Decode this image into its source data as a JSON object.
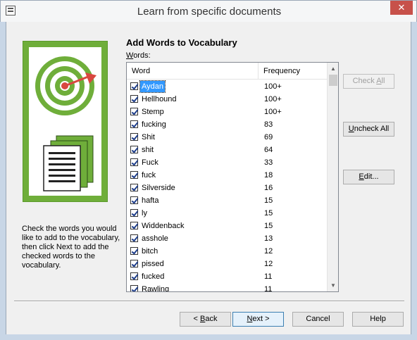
{
  "window": {
    "title": "Learn from specific documents"
  },
  "page": {
    "heading": "Add Words to Vocabulary",
    "words_label_accel": "W",
    "words_label_rest": "ords:",
    "instructions": "Check the words you would like to add to the vocabulary, then click Next to add the checked words to the vocabulary."
  },
  "list": {
    "columns": {
      "word": "Word",
      "frequency": "Frequency"
    },
    "rows": [
      {
        "word": "Aydan",
        "frequency": "100+",
        "checked": true,
        "selected": true
      },
      {
        "word": "Hellhound",
        "frequency": "100+",
        "checked": true
      },
      {
        "word": "Stemp",
        "frequency": "100+",
        "checked": true
      },
      {
        "word": "fucking",
        "frequency": "83",
        "checked": true
      },
      {
        "word": "Shit",
        "frequency": "69",
        "checked": true
      },
      {
        "word": "shit",
        "frequency": "64",
        "checked": true
      },
      {
        "word": "Fuck",
        "frequency": "33",
        "checked": true
      },
      {
        "word": "fuck",
        "frequency": "18",
        "checked": true
      },
      {
        "word": "Silverside",
        "frequency": "16",
        "checked": true
      },
      {
        "word": "hafta",
        "frequency": "15",
        "checked": true
      },
      {
        "word": "ly",
        "frequency": "15",
        "checked": true
      },
      {
        "word": "Widdenback",
        "frequency": "15",
        "checked": true
      },
      {
        "word": "asshole",
        "frequency": "13",
        "checked": true
      },
      {
        "word": "bitch",
        "frequency": "12",
        "checked": true
      },
      {
        "word": "pissed",
        "frequency": "12",
        "checked": true
      },
      {
        "word": "fucked",
        "frequency": "11",
        "checked": true
      },
      {
        "word": "Rawling",
        "frequency": "11",
        "checked": true
      }
    ]
  },
  "side_buttons": {
    "check_all": {
      "before": "Check ",
      "accel": "A",
      "after": "ll",
      "enabled": false
    },
    "uncheck_all": {
      "before": "",
      "accel": "U",
      "after": "ncheck All",
      "enabled": true
    },
    "edit": {
      "before": "",
      "accel": "E",
      "after": "dit...",
      "enabled": true
    }
  },
  "footer_buttons": {
    "back": {
      "before": "< ",
      "accel": "B",
      "after": "ack"
    },
    "next": {
      "before": "",
      "accel": "N",
      "after": "ext >"
    },
    "cancel": {
      "label": "Cancel"
    },
    "help": {
      "label": "Help"
    }
  },
  "icons": {
    "app": "document-window-icon",
    "close": "close-icon",
    "illustration": "target-documents-illustration",
    "checkbox": "check-icon",
    "scroll_up": "arrow-up-icon",
    "scroll_down": "arrow-down-icon"
  },
  "colors": {
    "illustration_green": "#6fae3a",
    "dart_red": "#d9473f",
    "selection": "#3399ff",
    "close_button": "#c7514a"
  }
}
